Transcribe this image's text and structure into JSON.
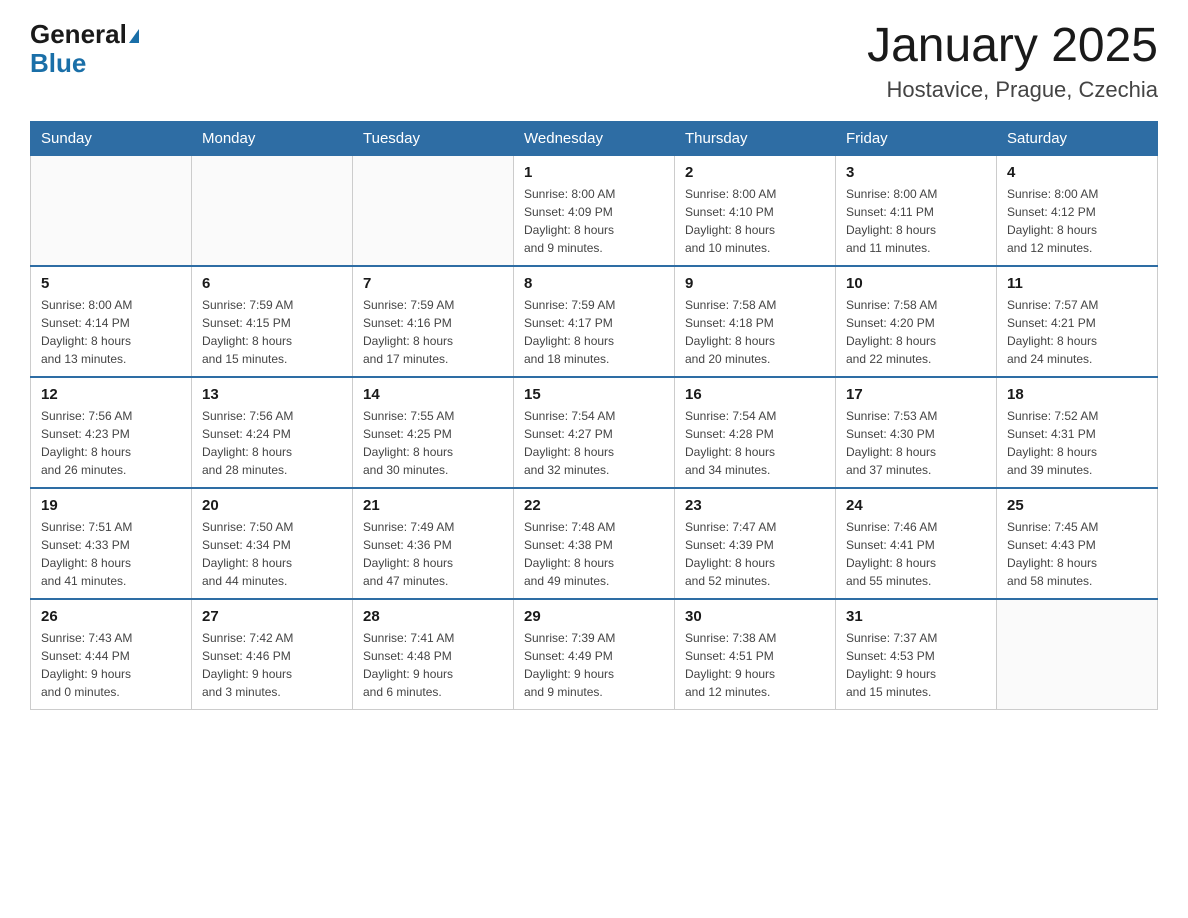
{
  "header": {
    "logo_general": "General",
    "logo_blue": "Blue",
    "month_title": "January 2025",
    "location": "Hostavice, Prague, Czechia"
  },
  "weekdays": [
    "Sunday",
    "Monday",
    "Tuesday",
    "Wednesday",
    "Thursday",
    "Friday",
    "Saturday"
  ],
  "weeks": [
    [
      {
        "day": "",
        "info": ""
      },
      {
        "day": "",
        "info": ""
      },
      {
        "day": "",
        "info": ""
      },
      {
        "day": "1",
        "info": "Sunrise: 8:00 AM\nSunset: 4:09 PM\nDaylight: 8 hours\nand 9 minutes."
      },
      {
        "day": "2",
        "info": "Sunrise: 8:00 AM\nSunset: 4:10 PM\nDaylight: 8 hours\nand 10 minutes."
      },
      {
        "day": "3",
        "info": "Sunrise: 8:00 AM\nSunset: 4:11 PM\nDaylight: 8 hours\nand 11 minutes."
      },
      {
        "day": "4",
        "info": "Sunrise: 8:00 AM\nSunset: 4:12 PM\nDaylight: 8 hours\nand 12 minutes."
      }
    ],
    [
      {
        "day": "5",
        "info": "Sunrise: 8:00 AM\nSunset: 4:14 PM\nDaylight: 8 hours\nand 13 minutes."
      },
      {
        "day": "6",
        "info": "Sunrise: 7:59 AM\nSunset: 4:15 PM\nDaylight: 8 hours\nand 15 minutes."
      },
      {
        "day": "7",
        "info": "Sunrise: 7:59 AM\nSunset: 4:16 PM\nDaylight: 8 hours\nand 17 minutes."
      },
      {
        "day": "8",
        "info": "Sunrise: 7:59 AM\nSunset: 4:17 PM\nDaylight: 8 hours\nand 18 minutes."
      },
      {
        "day": "9",
        "info": "Sunrise: 7:58 AM\nSunset: 4:18 PM\nDaylight: 8 hours\nand 20 minutes."
      },
      {
        "day": "10",
        "info": "Sunrise: 7:58 AM\nSunset: 4:20 PM\nDaylight: 8 hours\nand 22 minutes."
      },
      {
        "day": "11",
        "info": "Sunrise: 7:57 AM\nSunset: 4:21 PM\nDaylight: 8 hours\nand 24 minutes."
      }
    ],
    [
      {
        "day": "12",
        "info": "Sunrise: 7:56 AM\nSunset: 4:23 PM\nDaylight: 8 hours\nand 26 minutes."
      },
      {
        "day": "13",
        "info": "Sunrise: 7:56 AM\nSunset: 4:24 PM\nDaylight: 8 hours\nand 28 minutes."
      },
      {
        "day": "14",
        "info": "Sunrise: 7:55 AM\nSunset: 4:25 PM\nDaylight: 8 hours\nand 30 minutes."
      },
      {
        "day": "15",
        "info": "Sunrise: 7:54 AM\nSunset: 4:27 PM\nDaylight: 8 hours\nand 32 minutes."
      },
      {
        "day": "16",
        "info": "Sunrise: 7:54 AM\nSunset: 4:28 PM\nDaylight: 8 hours\nand 34 minutes."
      },
      {
        "day": "17",
        "info": "Sunrise: 7:53 AM\nSunset: 4:30 PM\nDaylight: 8 hours\nand 37 minutes."
      },
      {
        "day": "18",
        "info": "Sunrise: 7:52 AM\nSunset: 4:31 PM\nDaylight: 8 hours\nand 39 minutes."
      }
    ],
    [
      {
        "day": "19",
        "info": "Sunrise: 7:51 AM\nSunset: 4:33 PM\nDaylight: 8 hours\nand 41 minutes."
      },
      {
        "day": "20",
        "info": "Sunrise: 7:50 AM\nSunset: 4:34 PM\nDaylight: 8 hours\nand 44 minutes."
      },
      {
        "day": "21",
        "info": "Sunrise: 7:49 AM\nSunset: 4:36 PM\nDaylight: 8 hours\nand 47 minutes."
      },
      {
        "day": "22",
        "info": "Sunrise: 7:48 AM\nSunset: 4:38 PM\nDaylight: 8 hours\nand 49 minutes."
      },
      {
        "day": "23",
        "info": "Sunrise: 7:47 AM\nSunset: 4:39 PM\nDaylight: 8 hours\nand 52 minutes."
      },
      {
        "day": "24",
        "info": "Sunrise: 7:46 AM\nSunset: 4:41 PM\nDaylight: 8 hours\nand 55 minutes."
      },
      {
        "day": "25",
        "info": "Sunrise: 7:45 AM\nSunset: 4:43 PM\nDaylight: 8 hours\nand 58 minutes."
      }
    ],
    [
      {
        "day": "26",
        "info": "Sunrise: 7:43 AM\nSunset: 4:44 PM\nDaylight: 9 hours\nand 0 minutes."
      },
      {
        "day": "27",
        "info": "Sunrise: 7:42 AM\nSunset: 4:46 PM\nDaylight: 9 hours\nand 3 minutes."
      },
      {
        "day": "28",
        "info": "Sunrise: 7:41 AM\nSunset: 4:48 PM\nDaylight: 9 hours\nand 6 minutes."
      },
      {
        "day": "29",
        "info": "Sunrise: 7:39 AM\nSunset: 4:49 PM\nDaylight: 9 hours\nand 9 minutes."
      },
      {
        "day": "30",
        "info": "Sunrise: 7:38 AM\nSunset: 4:51 PM\nDaylight: 9 hours\nand 12 minutes."
      },
      {
        "day": "31",
        "info": "Sunrise: 7:37 AM\nSunset: 4:53 PM\nDaylight: 9 hours\nand 15 minutes."
      },
      {
        "day": "",
        "info": ""
      }
    ]
  ]
}
